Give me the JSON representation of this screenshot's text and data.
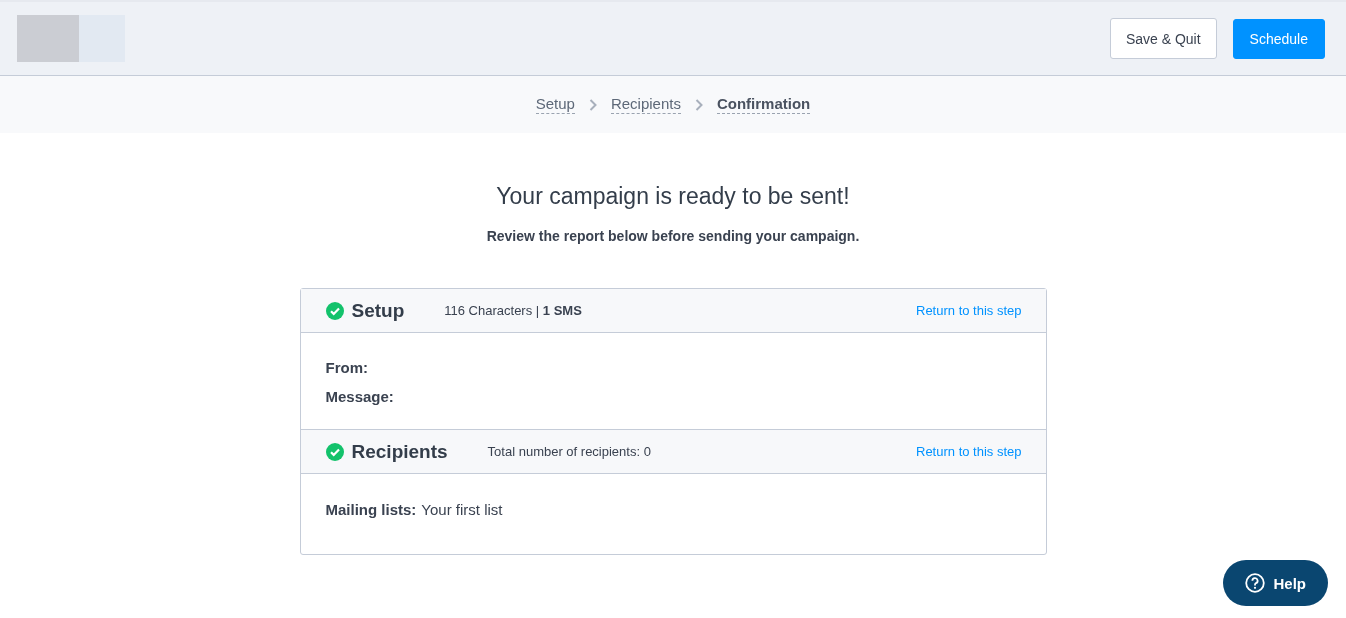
{
  "header": {
    "buttons": [
      {
        "label": "Save & Quit",
        "kind": "secondary"
      },
      {
        "label": "Schedule",
        "kind": "primary"
      }
    ]
  },
  "steps": [
    {
      "label": "Setup",
      "selected": false
    },
    {
      "label": "Recipients",
      "selected": false
    },
    {
      "label": "Confirmation",
      "selected": true
    }
  ],
  "title": "Your campaign is ready to be sent!",
  "subtitle": "Review the report below before sending your campaign.",
  "sections": [
    {
      "title": "Setup",
      "complete": true,
      "summary": "116 Characters | **1 SMS**",
      "link": "Return to this step",
      "fields": [
        {
          "label": "From:"
        },
        {
          "label": "Message:"
        }
      ]
    },
    {
      "title": "Recipients",
      "complete": true,
      "summary": "Total number of recipients: 0",
      "link": "Return to this step",
      "fields": [
        {
          "label": "Mailing lists:",
          "value": "Your first list"
        }
      ]
    }
  ],
  "help": {
    "label": "Help"
  }
}
